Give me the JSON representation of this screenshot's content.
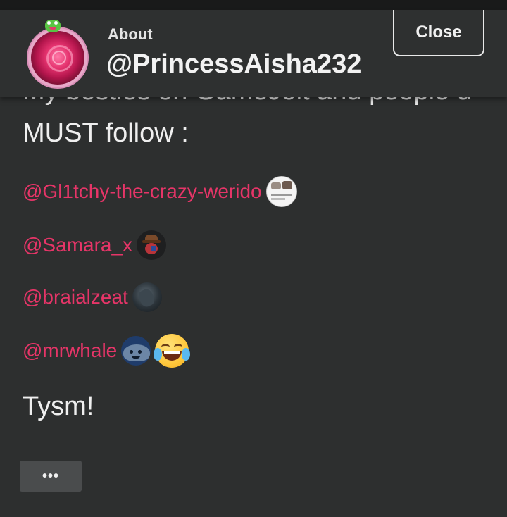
{
  "header": {
    "about_label": "About",
    "username": "@PrincessAisha232",
    "close_label": "Close"
  },
  "bio": {
    "cut_line": "My besties on GameJolt and people u",
    "intro": "MUST follow :",
    "mentions": [
      {
        "handle": "@Gl1tchy-the-crazy-werido",
        "avatar": "user-avatar"
      },
      {
        "handle": "@Samara_x",
        "avatar": "user-avatar"
      },
      {
        "handle": "@braialzeat",
        "avatar": "user-avatar"
      },
      {
        "handle": "@mrwhale",
        "avatar": "user-avatar"
      }
    ],
    "emoji": "face-with-tears-of-joy-icon",
    "closing": "Tysm!"
  },
  "more_button": {
    "label": "•••"
  },
  "colors": {
    "background": "#2d2f2f",
    "mention": "#e63568",
    "text": "#efefef"
  }
}
